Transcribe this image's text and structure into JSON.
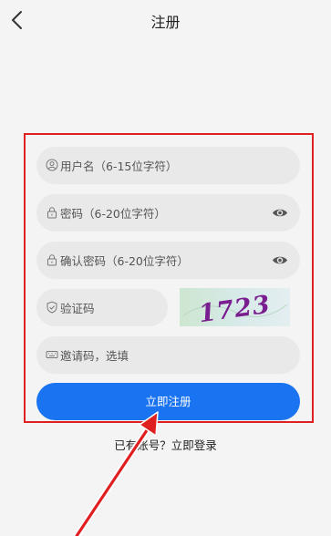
{
  "header": {
    "title": "注册"
  },
  "form": {
    "username_placeholder": "用户名（6-15位字符）",
    "password_placeholder": "密码（6-20位字符）",
    "confirm_password_placeholder": "确认密码（6-20位字符）",
    "captcha_placeholder": "验证码",
    "captcha_text": "1723",
    "invite_placeholder": "邀请码，选填",
    "submit_label": "立即注册"
  },
  "footer": {
    "has_account_text": "已有账号？",
    "login_link": "立即登录"
  },
  "colors": {
    "accent": "#1a73f0",
    "highlight": "#e02020",
    "captcha_text": "#7a1f8f",
    "field_bg": "#e9e9e9"
  },
  "icons": {
    "back": "chevron-left-icon",
    "username": "user-icon",
    "password": "lock-icon",
    "confirm_password": "lock-icon",
    "captcha": "shield-check-icon",
    "invite": "keyboard-icon",
    "toggle_visibility": "eye-icon"
  }
}
